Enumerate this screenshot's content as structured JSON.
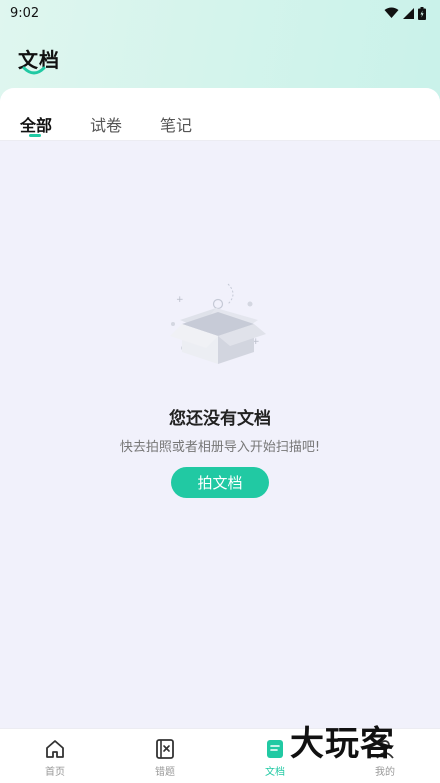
{
  "status": {
    "time": "9:02"
  },
  "header": {
    "title": "文档"
  },
  "tabs": [
    {
      "label": "全部"
    },
    {
      "label": "试卷"
    },
    {
      "label": "笔记"
    }
  ],
  "empty": {
    "title": "您还没有文档",
    "subtitle": "快去拍照或者相册导入开始扫描吧!",
    "button": "拍文档"
  },
  "nav": [
    {
      "label": "首页",
      "icon": "home-icon"
    },
    {
      "label": "错题",
      "icon": "wrong-questions-icon"
    },
    {
      "label": "文档",
      "icon": "document-icon"
    },
    {
      "label": "我的",
      "icon": "profile-icon"
    }
  ],
  "watermark": "大玩客",
  "colors": {
    "accent": "#21c9a3",
    "header_bg": "#d5f4ec",
    "page_bg": "#f1f1fb"
  }
}
